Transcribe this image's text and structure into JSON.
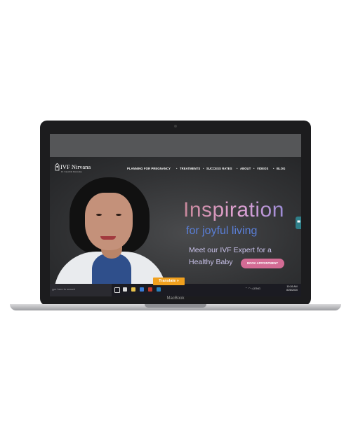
{
  "laptop": {
    "brand_label": "MacBook"
  },
  "site": {
    "logo": {
      "name": "IVF Nirvana",
      "subtitle": "Dr. Kaushiki Dwivedee"
    },
    "nav": [
      "PLANNING FOR PREGNANCY",
      "TREATMENTS",
      "SUCCESS RATES",
      "ABOUT",
      "VIDEOS",
      "BLOG"
    ],
    "hero": {
      "headline": "Inspiration",
      "subheadline": "for joyful living",
      "line1": "Meet our IVF Expert for a",
      "line2": "Healthy Baby",
      "cta": "BOOK APPOINTMENT"
    },
    "translate_label": "Translate »"
  },
  "taskbar": {
    "search_placeholder": "ype here to search",
    "tray": "ENG",
    "time": "10:26 AM",
    "date": "8/28/2020",
    "lang_sub": "IN"
  },
  "colors": {
    "accent_pink": "#d36b94",
    "headline_blue": "#5a7fd8",
    "translate_orange": "#f0a01e"
  }
}
